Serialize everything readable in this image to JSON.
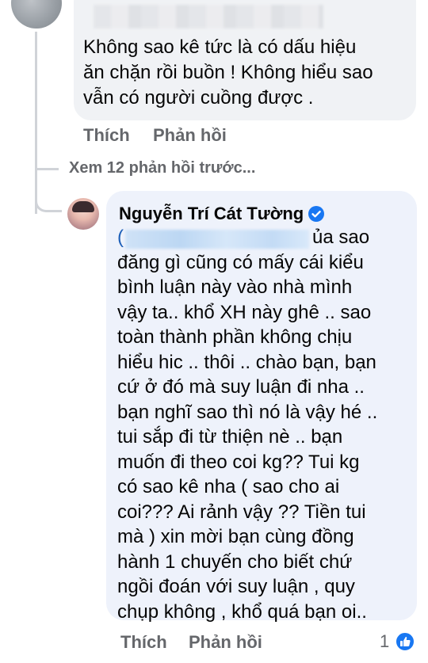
{
  "first_comment": {
    "text_lines": [
      "Không sao kê tức là có dấu hiệu",
      "ăn chặn rồi buồn ! Không hiểu sao",
      "vẫn có người cuồng được ."
    ],
    "like_label": "Thích",
    "reply_label": "Phản hồi"
  },
  "thread": {
    "view_previous_label": "Xem 12 phản hồi trước..."
  },
  "reply": {
    "author": "Nguyễn Trí Cát Tường",
    "mention_open": "(",
    "first_line_rest": "ủa sao",
    "text_lines": [
      "đăng gì cũng có mấy cái kiểu",
      "bình luận này vào nhà mình",
      "vậy ta.. khổ XH này ghê .. sao",
      "toàn thành phần không chịu",
      "hiểu hic .. thôi .. chào bạn, bạn",
      "cứ ở đó mà suy luận đi nha ..",
      "bạn nghĩ sao thì nó là vậy hé ..",
      "tui sắp đi từ thiện nè .. bạn",
      "muốn đi theo coi kg?? Tui kg",
      "có sao kê nha ( sao cho ai",
      "coi??? Ai rảnh vậy ?? Tiền tui",
      "mà ) xin mời bạn cùng đồng",
      "hành 1 chuyến cho biết chứ",
      "ngồi đoán với suy luận , quy",
      "chụp không , khổ quá bạn oi.."
    ],
    "like_label": "Thích",
    "reply_label": "Phản hồi",
    "reaction_count": "1"
  },
  "icons": {
    "verified": "verified-badge-icon",
    "reaction": "like-reaction-icon"
  },
  "colors": {
    "reply_bubble": "#eef2fb",
    "comment_bubble": "#f0f2f5",
    "muted_text": "#65676b",
    "facebook_blue": "#1877f2"
  }
}
